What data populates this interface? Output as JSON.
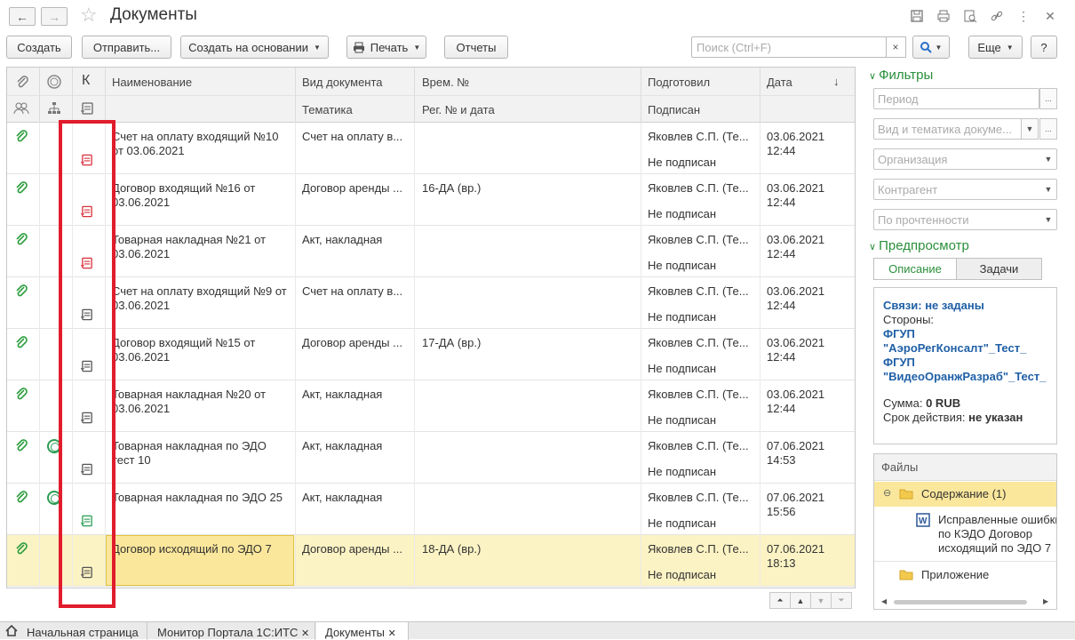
{
  "window": {
    "title": "Документы",
    "back_icon": "←",
    "forward_icon": "→"
  },
  "toolbar": {
    "create": "Создать",
    "send": "Отправить...",
    "create_based": "Создать на основании",
    "print": "Печать",
    "reports": "Отчеты",
    "search_placeholder": "Поиск (Ctrl+F)",
    "clear": "×",
    "more": "Еще",
    "help": "?"
  },
  "table": {
    "headers": {
      "k": "К",
      "name": "Наименование",
      "doctype": "Вид документа",
      "topic": "Тематика",
      "tempnum": "Врем. №",
      "regnum": "Рег. № и дата",
      "prepared": "Подготовил",
      "signed": "Подписан",
      "date": "Дата",
      "sort": "↓"
    },
    "rows": [
      {
        "name": "Счет на оплату входящий №10 от 03.06.2021",
        "doctype": "Счет на оплату в...",
        "tempnum": "",
        "prepared": "Яковлев С.П. (Те...",
        "signed": "Не подписан",
        "date": "03.06.2021",
        "time": "12:44"
      },
      {
        "name": "Договор входящий №16 от 03.06.2021",
        "doctype": "Договор аренды ...",
        "tempnum": "16-ДА (вр.)",
        "prepared": "Яковлев С.П. (Те...",
        "signed": "Не подписан",
        "date": "03.06.2021",
        "time": "12:44"
      },
      {
        "name": "Товарная накладная №21 от 03.06.2021",
        "doctype": "Акт, накладная",
        "tempnum": "",
        "prepared": "Яковлев С.П. (Те...",
        "signed": "Не подписан",
        "date": "03.06.2021",
        "time": "12:44"
      },
      {
        "name": "Счет на оплату входящий №9 от 03.06.2021",
        "doctype": "Счет на оплату в...",
        "tempnum": "",
        "prepared": "Яковлев С.П. (Те...",
        "signed": "Не подписан",
        "date": "03.06.2021",
        "time": "12:44"
      },
      {
        "name": "Договор входящий №15 от 03.06.2021",
        "doctype": "Договор аренды ...",
        "tempnum": "17-ДА (вр.)",
        "prepared": "Яковлев С.П. (Те...",
        "signed": "Не подписан",
        "date": "03.06.2021",
        "time": "12:44"
      },
      {
        "name": "Товарная накладная №20 от 03.06.2021",
        "doctype": "Акт, накладная",
        "tempnum": "",
        "prepared": "Яковлев С.П. (Те...",
        "signed": "Не подписан",
        "date": "03.06.2021",
        "time": "12:44"
      },
      {
        "name": "Товарная накладная по ЭДО тест 10",
        "doctype": "Акт, накладная",
        "tempnum": "",
        "prepared": "Яковлев С.П. (Те...",
        "signed": "Не подписан",
        "date": "07.06.2021",
        "time": "14:53"
      },
      {
        "name": "Товарная накладная по ЭДО 25",
        "doctype": "Акт, накладная",
        "tempnum": "",
        "prepared": "Яковлев С.П. (Те...",
        "signed": "Не подписан",
        "date": "07.06.2021",
        "time": "15:56"
      },
      {
        "name": "Договор исходящий по ЭДО 7",
        "doctype": "Договор аренды ...",
        "tempnum": "18-ДА (вр.)",
        "prepared": "Яковлев С.П. (Те...",
        "signed": "Не подписан",
        "date": "07.06.2021",
        "time": "18:13"
      }
    ]
  },
  "colors": {
    "icon_red": "#d9313c",
    "icon_gray": "#555555",
    "icon_green": "#2a9d52",
    "clip_green": "#2e9e3f"
  },
  "filters": {
    "title": "Фильтры",
    "period": "Период",
    "period_btn": "...",
    "doctype": "Вид и тематика докуме...",
    "doctype_btn": "...",
    "org": "Организация",
    "contractor": "Контрагент",
    "read": "По прочтенности"
  },
  "preview": {
    "title": "Предпросмотр",
    "tab_desc": "Описание",
    "tab_tasks": "Задачи",
    "links": "Связи: не заданы",
    "sides_label": "Стороны:",
    "party1_a": "ФГУП",
    "party1_b": "\"АэроРегКонсалт\"_Тест_",
    "party2_a": "ФГУП",
    "party2_b": "\"ВидеоОранжРазраб\"_Тест_",
    "sum_label": "Сумма:",
    "sum_value": "0 RUB",
    "term_label": "Срок действия:",
    "term_value": "не указан"
  },
  "files": {
    "header": "Файлы",
    "content": "Содержание (1)",
    "file1_a": "Исправленные ошибки",
    "file1_b": "по КЭДО Договор",
    "file1_c": "исходящий по ЭДО 7",
    "appendix": "Приложение"
  },
  "bottom_tabs": {
    "home": "Начальная страница",
    "monitor": "Монитор Портала 1С:ИТС",
    "docs": "Документы"
  }
}
